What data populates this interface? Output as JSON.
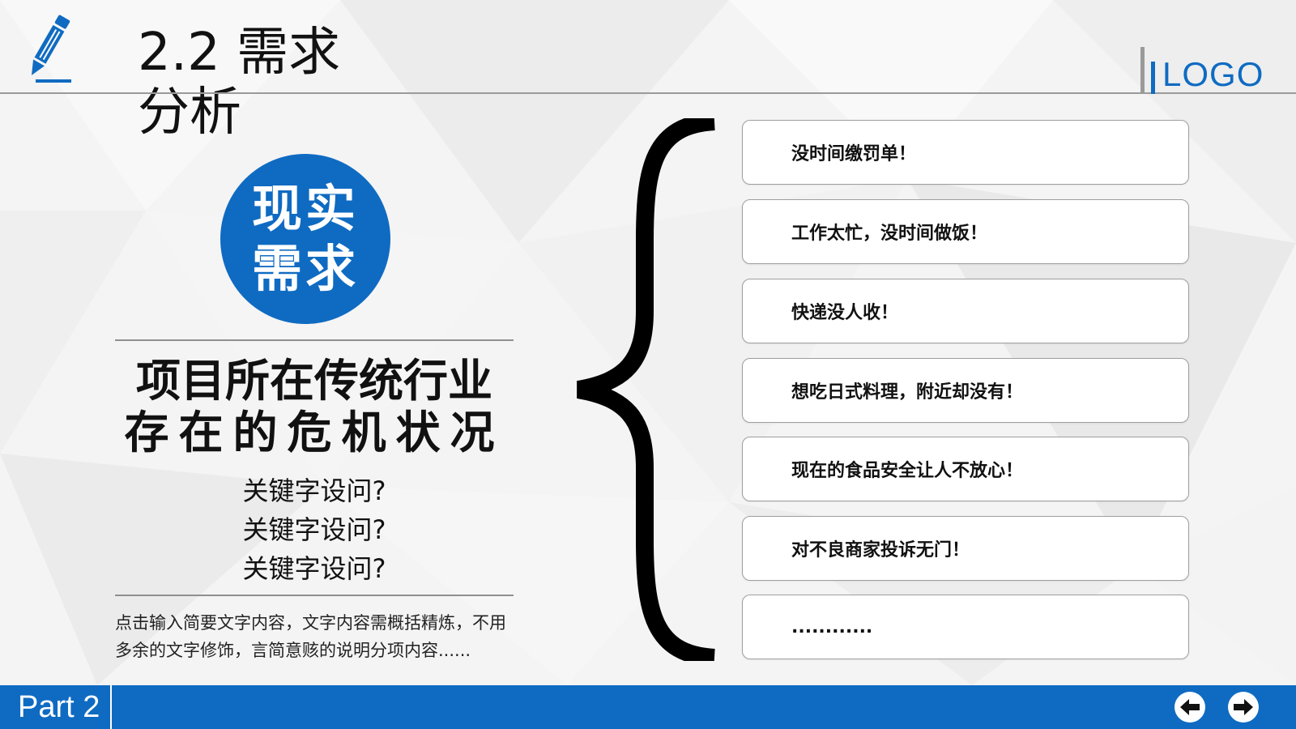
{
  "header": {
    "title": "2.2 需求分析",
    "logo_text": "LOGO"
  },
  "circle": {
    "text": "现实需求"
  },
  "headline": {
    "line1": "项目所在传统行业",
    "line2": "存在的危机状况"
  },
  "keywords": [
    "关键字设问?",
    "关键字设问?",
    "关键字设问?"
  ],
  "description": "点击输入简要文字内容，文字内容需概括精炼，不用多余的文字修饰，言简意赅的说明分项内容......",
  "items": [
    "没时间缴罚单！",
    "工作太忙，没时间做饭！",
    "快递没人收！",
    "想吃日式料理，附近却没有！",
    "现在的食品安全让人不放心！",
    "对不良商家投诉无门！",
    "............"
  ],
  "footer": {
    "part_label": "Part 2"
  },
  "colors": {
    "accent": "#0f6bc2",
    "text": "#111111",
    "border": "#9e9e9e"
  },
  "icons": {
    "header": "pencil-icon",
    "prev": "arrow-left-icon",
    "next": "arrow-right-icon"
  }
}
